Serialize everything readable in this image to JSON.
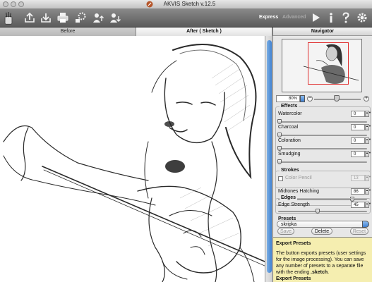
{
  "window": {
    "title": "AKVIS Sketch v.12.5"
  },
  "toolbar": {
    "icons": [
      "brush-icon",
      "open-icon",
      "save-icon",
      "print-icon",
      "batch-icon",
      "upload-icon",
      "download-icon"
    ],
    "mode_express": "Express",
    "mode_advanced": "Advanced",
    "right_icons": [
      "run-icon",
      "info-icon",
      "help-icon",
      "settings-icon"
    ]
  },
  "tabs": {
    "before": "Before",
    "after": "After ( Sketch )"
  },
  "navigator": {
    "title": "Navigator",
    "zoom": "80%"
  },
  "effects": {
    "title": "Effects",
    "watercolor": {
      "label": "Watercolor",
      "value": "0",
      "level": 0
    },
    "charcoal": {
      "label": "Charcoal",
      "value": "0",
      "level": 0
    },
    "coloration": {
      "label": "Coloration",
      "value": "0",
      "level": 0
    },
    "smudging": {
      "label": "Smudging",
      "value": "0",
      "level": 0
    }
  },
  "strokes": {
    "title": "Strokes",
    "color_pencil": {
      "label": "Color Pencil",
      "value": "13",
      "enabled": false
    },
    "midtones": {
      "label": "Midtones Hatching",
      "value": "86",
      "level": 86
    }
  },
  "edges": {
    "title": "Edges",
    "edge_strength": {
      "label": "Edge Strength",
      "value": "45",
      "level": 45
    }
  },
  "presets": {
    "title": "Presets",
    "selected": "skripka",
    "save": "Save",
    "delete": "Delete",
    "reset": "Reset"
  },
  "help": {
    "title": "Export Presets",
    "body_1": "The button exports presets (user settings for the image processing). You can save any number of presets to a separate file with the ending",
    "ext": ".sketch",
    "body_2": ".",
    "footer": "Export Presets"
  },
  "colors": {
    "accent_blue": "#3d7fcf",
    "help_bg": "#f5eeb0",
    "toolbar_dark": "#5b5b5b"
  }
}
